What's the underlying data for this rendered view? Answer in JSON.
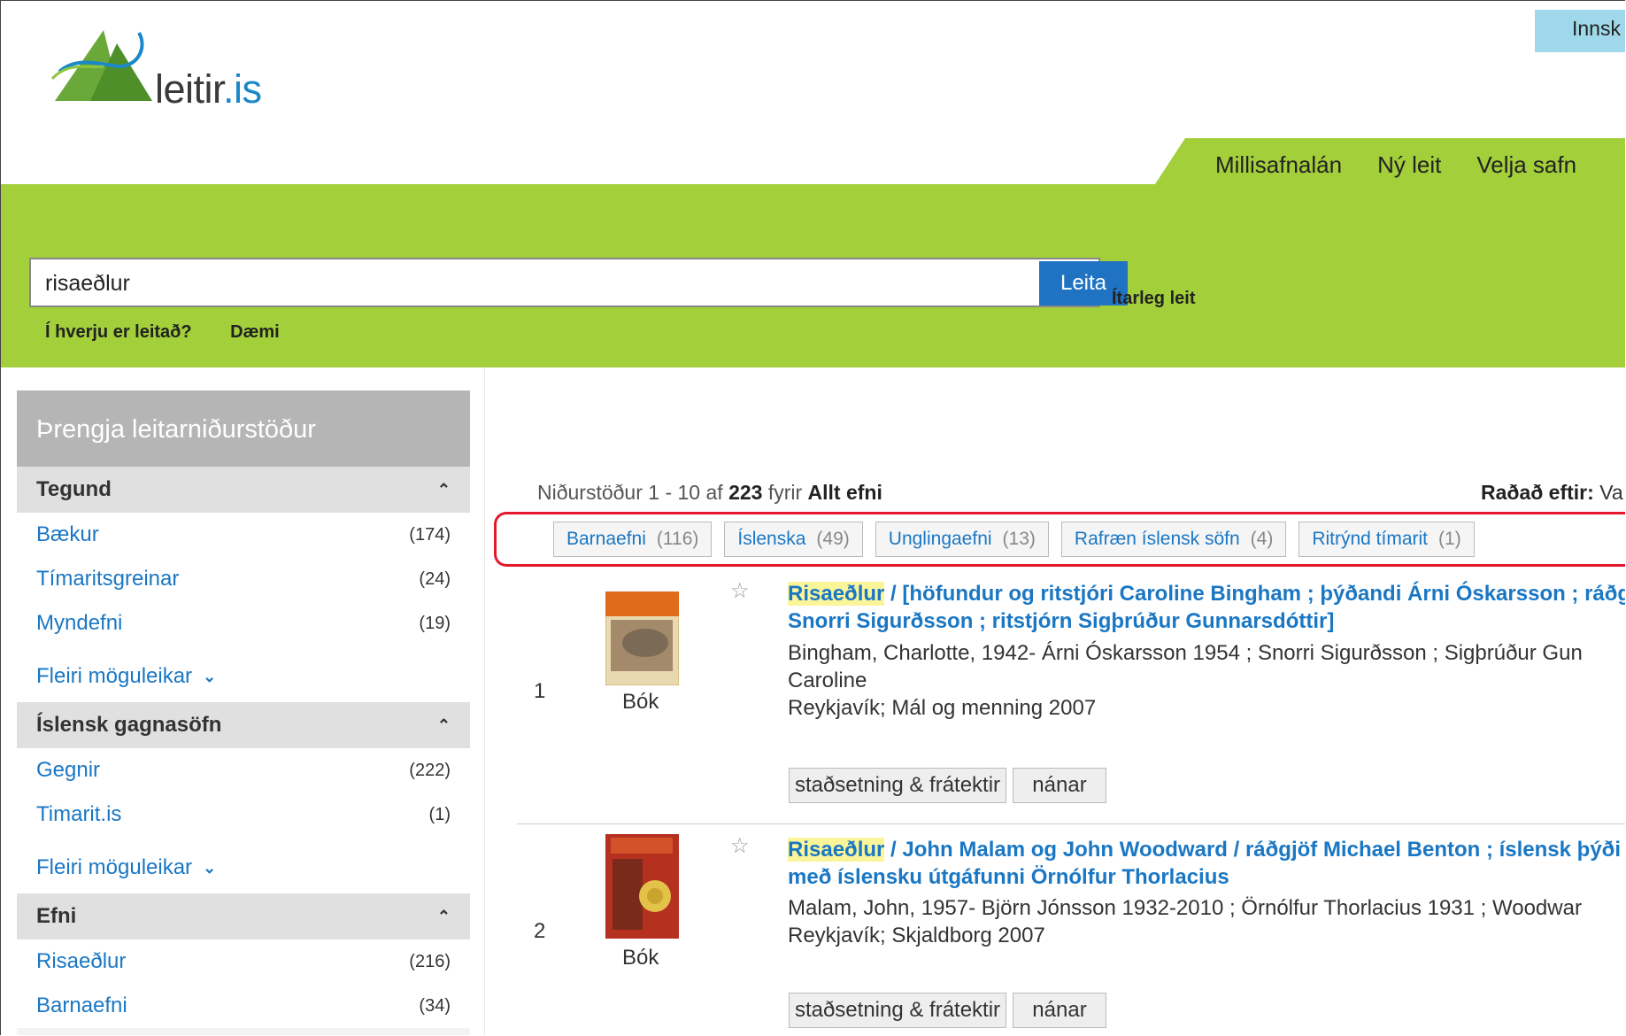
{
  "header": {
    "logo_text": "leitir",
    "logo_tld": ".is",
    "login_label": "Innsk",
    "nav": [
      "Millisafnalán",
      "Ný leit",
      "Velja safn"
    ]
  },
  "search": {
    "value": "risaeðlur",
    "button": "Leita",
    "advanced": "Ítarleg leit",
    "help": [
      "Í hverju er leitað?",
      "Dæmi"
    ]
  },
  "sidebar": {
    "title": "Þrengja leitarniðurstöður",
    "facets": [
      {
        "title": "Tegund",
        "items": [
          {
            "label": "Bækur",
            "count": "(174)"
          },
          {
            "label": "Tímaritsgreinar",
            "count": "(24)"
          },
          {
            "label": "Myndefni",
            "count": "(19)"
          }
        ],
        "more": "Fleiri möguleikar"
      },
      {
        "title": "Íslensk gagnasöfn",
        "items": [
          {
            "label": "Gegnir",
            "count": "(222)"
          },
          {
            "label": "Timarit.is",
            "count": "(1)"
          }
        ],
        "more": "Fleiri möguleikar"
      },
      {
        "title": "Efni",
        "items": [
          {
            "label": "Risaeðlur",
            "count": "(216)"
          },
          {
            "label": "Barnaefni",
            "count": "(34)"
          }
        ]
      }
    ]
  },
  "results_header": {
    "prefix": "Niðurstöður 1 - 10 af",
    "total": "223",
    "mid": "fyrir",
    "scope": "Allt efni",
    "sort_label": "Raðað eftir:",
    "sort_value": "Va"
  },
  "chips": [
    {
      "label": "Barnaefni",
      "count": "(116)"
    },
    {
      "label": "Íslenska",
      "count": "(49)"
    },
    {
      "label": "Unglingaefni",
      "count": "(13)"
    },
    {
      "label": "Rafræn íslensk söfn",
      "count": "(4)"
    },
    {
      "label": "Ritrýnd tímarit",
      "count": "(1)"
    }
  ],
  "results": [
    {
      "num": "1",
      "type": "Bók",
      "title_hl": "Risaeðlur",
      "title_rest": " / [höfundur og ritstjóri Caroline Bingham ; þýðandi Árni Óskarsson ; ráðg",
      "title_line2": "Snorri Sigurðsson ; ritstjórn Sigþrúður Gunnarsdóttir]",
      "authors": "Bingham, Charlotte, 1942- Árni Óskarsson 1954 ; Snorri Sigurðsson ; Sigþrúður Gun",
      "authors2": "Caroline",
      "pub": "Reykjavík; Mál og menning 2007",
      "btn_location": "staðsetning & frátektir",
      "btn_more": "nánar"
    },
    {
      "num": "2",
      "type": "Bók",
      "title_hl": "Risaeðlur",
      "title_rest": " / John Malam og John Woodward / ráðgjöf Michael Benton ; íslensk þýði",
      "title_line2": "með íslensku útgáfunni Örnólfur Thorlacius",
      "authors": "Malam, John, 1957- Björn Jónsson 1932-2010 ; Örnólfur Thorlacius 1931 ; Woodwar",
      "pub": "Reykjavík; Skjaldborg 2007",
      "btn_location": "staðsetning & frátektir",
      "btn_more": "nánar"
    }
  ],
  "colors": {
    "green": "#a3cf3b",
    "link": "#1a77c4",
    "button": "#1f73c2",
    "highlight": "#fbf59a",
    "red_outline": "#e5172d"
  }
}
